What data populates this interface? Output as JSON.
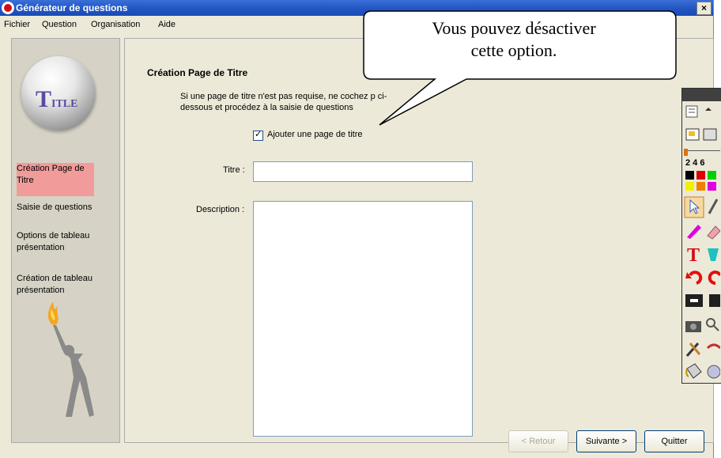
{
  "window": {
    "title": "Générateur de questions",
    "close": "×"
  },
  "menu": [
    "Fichier",
    "Question",
    "Organisation",
    "Aide"
  ],
  "logo": {
    "initial": "T",
    "rest": "ITLE"
  },
  "nav": [
    "Création Page de Titre",
    "Saisie de questions",
    "Options de tableau présentation",
    "Création de tableau présentation"
  ],
  "main": {
    "heading": "Création Page de Titre",
    "info": "Si une page de titre n'est pas requise, ne cochez p ci-dessous et procédez à la saisie de questions",
    "checkbox_label": "Ajouter une page de titre",
    "checkbox_checked": true,
    "titre_label": "Titre :",
    "titre_value": "",
    "description_label": "Description :",
    "description_value": ""
  },
  "buttons": {
    "back": "< Retour",
    "next": "Suivante >",
    "quit": "Quitter"
  },
  "callout": {
    "line1": "Vous pouvez désactiver",
    "line2": "cette option."
  },
  "toolbar": {
    "pen_sizes": "2 4 6"
  },
  "colors": {
    "titlebar": "#2357c4",
    "active_nav": "#f29b9b",
    "window_bg": "#ece9d8"
  }
}
